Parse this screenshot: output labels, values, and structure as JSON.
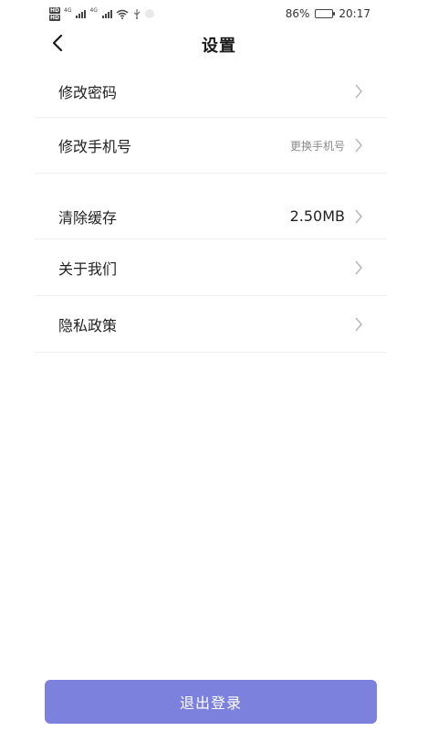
{
  "status_bar": {
    "hd_badge_1": "HD",
    "hd_badge_2": "HD",
    "net_1": "4G",
    "net_2": "4G",
    "battery_percent": "86%",
    "battery_level": 0.86,
    "time": "20:17"
  },
  "header": {
    "title": "设置",
    "back_icon": "chevron-left-icon"
  },
  "settings": {
    "change_password": {
      "label": "修改密码"
    },
    "change_phone": {
      "label": "修改手机号",
      "hint": "更换手机号"
    },
    "clear_cache": {
      "label": "清除缓存",
      "value": "2.50MB"
    },
    "about_us": {
      "label": "关于我们"
    },
    "privacy_policy": {
      "label": "隐私政策"
    }
  },
  "logout": {
    "label": "退出登录"
  },
  "colors": {
    "primary": "#7b81dd",
    "divider": "#efefef",
    "hint_text": "#8a8a8a"
  }
}
